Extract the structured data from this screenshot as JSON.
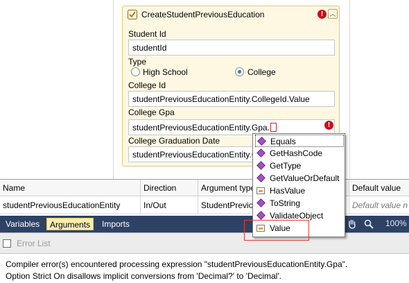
{
  "activity": {
    "title": "CreateStudentPreviousEducation",
    "fields": {
      "student_id_label": "Student Id",
      "student_id_value": "studentId",
      "type_label": "Type",
      "college_id_label": "College Id",
      "college_id_value": "studentPreviousEducationEntity.CollegeId.Value",
      "college_gpa_label": "College Gpa",
      "college_gpa_value": "studentPreviousEducationEntity.Gpa.",
      "graduation_label": "College Graduation Date",
      "graduation_value": "studentPreviousEducationEntity.Co"
    },
    "type_options": [
      {
        "label": "High School",
        "selected": false
      },
      {
        "label": "College",
        "selected": true
      }
    ],
    "error_icon": "!"
  },
  "arguments_grid": {
    "headers": [
      "Name",
      "Direction",
      "Argument type",
      "Default value"
    ],
    "rows": [
      {
        "name": "studentPreviousEducationEntity",
        "direction": "In/Out",
        "type": "StudentPrevious",
        "default": "Default value n"
      }
    ]
  },
  "tabbar": {
    "tabs": [
      {
        "label": "Variables",
        "selected": false
      },
      {
        "label": "Arguments",
        "selected": true
      },
      {
        "label": "Imports",
        "selected": false
      }
    ],
    "zoom": "100%"
  },
  "error_list": {
    "title": "Error List",
    "lines": [
      "Compiler error(s) encountered processing expression \"studentPreviousEducationEntity.Gpa\".",
      "Option Strict On disallows implicit conversions from 'Decimal?' to 'Decimal'."
    ]
  },
  "intellisense": {
    "items": [
      {
        "label": "Equals",
        "kind": "method",
        "selected": true
      },
      {
        "label": "GetHashCode",
        "kind": "method",
        "selected": false
      },
      {
        "label": "GetType",
        "kind": "method",
        "selected": false
      },
      {
        "label": "GetValueOrDefault",
        "kind": "method",
        "selected": false
      },
      {
        "label": "HasValue",
        "kind": "property",
        "selected": false
      },
      {
        "label": "ToString",
        "kind": "method",
        "selected": false
      },
      {
        "label": "ValidateObject",
        "kind": "extension-method",
        "selected": false
      },
      {
        "label": "Value",
        "kind": "property",
        "selected": false
      }
    ]
  },
  "colors": {
    "activity_bg": "#fef8e2",
    "activity_border": "#e3c777",
    "error_red": "#c8121f",
    "tabbar_bg": "#2e4265",
    "tab_selected_bg": "#fcedb4",
    "method_icon": "#a64fc3",
    "annotation_red": "#e23b3b"
  }
}
